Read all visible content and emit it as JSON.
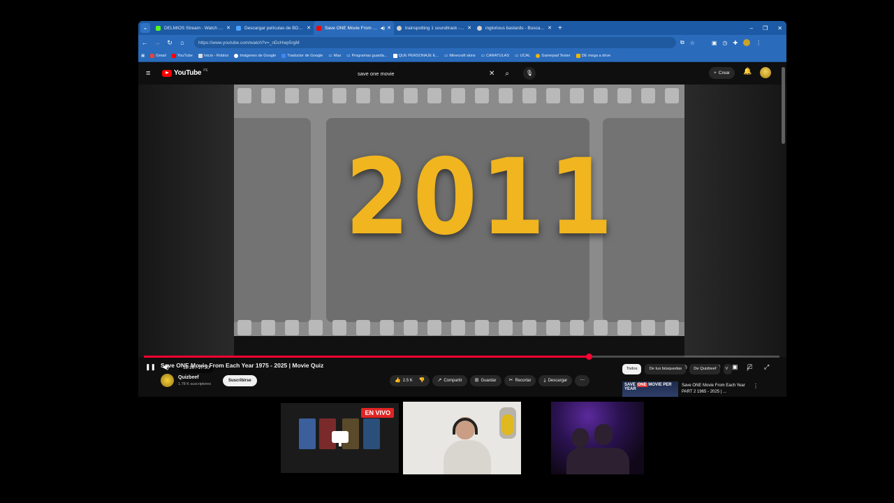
{
  "browser": {
    "tabs": [
      {
        "title": "DELMIOS Stream - Watch Live",
        "favicon_color": "#53fc18",
        "active": false,
        "audio": false
      },
      {
        "title": "Descargar películas de BD25 en",
        "favicon_color": "#4aa3ff",
        "active": false,
        "audio": false
      },
      {
        "title": "Save ONE Movie From Each",
        "favicon_color": "#ff0000",
        "active": true,
        "audio": true
      },
      {
        "title": "trainspotting 1 soundtrack - Bu",
        "favicon_color": "#d0d0d0",
        "active": false,
        "audio": false
      },
      {
        "title": "inglorious bastards - Buscar co",
        "favicon_color": "#d0d0d0",
        "active": false,
        "audio": false
      }
    ],
    "url": "https://www.youtube.com/watch?v=_nDcHwp5rgM",
    "bookmarks": [
      "Gmail",
      "YouTube",
      "Inicio - Roblox",
      "Imágenes de Google",
      "Traductor de Google",
      "Mas",
      "Programas guarda...",
      "QUE PERSONAJE E...",
      "Minecraft skins",
      "CARATULAS",
      "UCAL",
      "Gamepad Tester",
      "DE mega a drive"
    ]
  },
  "youtube": {
    "logo_text": "YouTube",
    "country_code": "PE",
    "search_query": "save one movie",
    "create_label": "Crear",
    "player": {
      "year_text": "2011",
      "current_time": "12:16",
      "duration": "17:30",
      "time_display": "12:16 / 17:30",
      "progress_fraction": 0.7
    },
    "video_title": "Save ONE Movie From Each Year 1975 - 2025 | Movie Quiz",
    "channel": {
      "name": "Quizbeef",
      "subscribers": "1.78 K suscriptores",
      "subscribe_label": "Suscribirse"
    },
    "actions": {
      "likes": "2.5 K",
      "share": "Compartir",
      "save": "Guardar",
      "clip": "Recortar",
      "download": "Descargar"
    },
    "chips": [
      "Todos",
      "De tus búsquedas",
      "De Quizbeef",
      "V"
    ],
    "recommendation": {
      "thumb_text_1": "SAVE",
      "thumb_text_2": "ONE",
      "thumb_text_3": "MOVIE PER YEAR",
      "title": "Save ONE Movie From Each Year PART 2 1965 - 2025 | ..."
    }
  },
  "overlay": {
    "live_label": "EN VIVO"
  }
}
